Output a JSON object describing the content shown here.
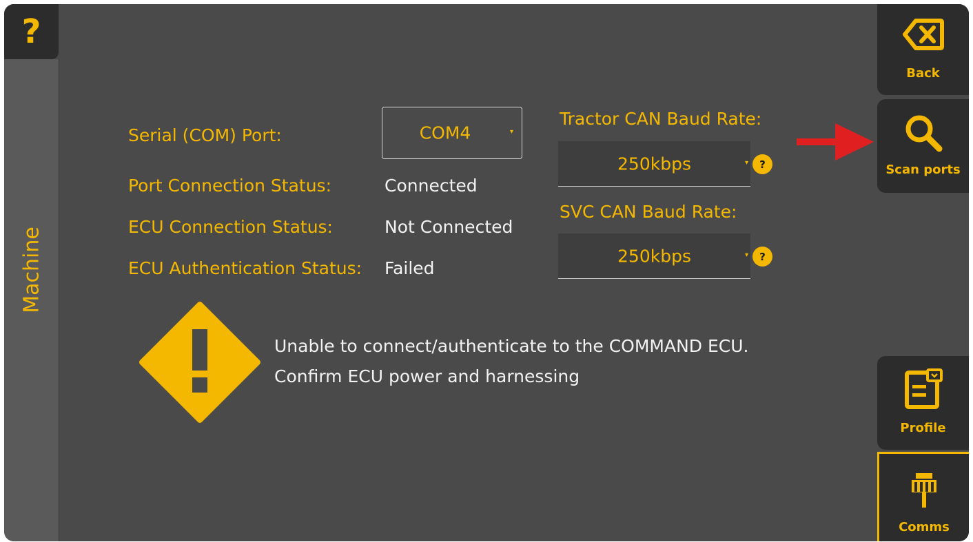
{
  "help_button": {
    "label": "?"
  },
  "side_tab": {
    "label": "Machine"
  },
  "form": {
    "serial_port_label": "Serial (COM) Port:",
    "serial_port_value": "COM4",
    "port_status_label": "Port Connection Status:",
    "port_status_value": "Connected",
    "ecu_status_label": "ECU Connection Status:",
    "ecu_status_value": "Not Connected",
    "ecu_auth_label": "ECU Authentication Status:",
    "ecu_auth_value": "Failed",
    "tractor_can_label": "Tractor CAN Baud Rate:",
    "tractor_can_value": "250kbps",
    "svc_can_label": "SVC CAN Baud Rate:",
    "svc_can_value": "250kbps",
    "help_mark": "?"
  },
  "warning": {
    "line1": "Unable to connect/authenticate to the COMMAND ECU.",
    "line2": "Confirm ECU power and harnessing"
  },
  "right_panel": {
    "back_label": "Back",
    "scan_label": "Scan ports",
    "profile_label": "Profile",
    "comms_label": "Comms"
  },
  "colors": {
    "accent": "#f5b800",
    "background": "#4a4a4a",
    "panel": "#2c2c2c",
    "annotation_arrow": "#e02020"
  }
}
